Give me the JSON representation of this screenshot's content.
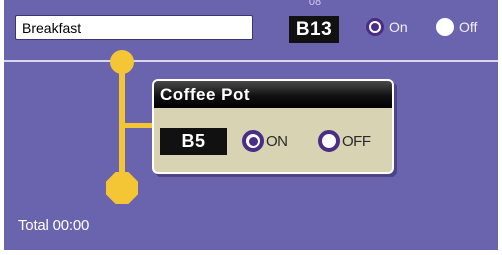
{
  "header": {
    "schedule_name": "Breakfast",
    "code": "B13",
    "code_shadow": "08",
    "on_label": "On",
    "off_label": "Off",
    "selected": "on"
  },
  "popup": {
    "title": "Coffee Pot",
    "code": "B5",
    "on_label": "ON",
    "off_label": "OFF",
    "selected": "on"
  },
  "footer": {
    "total_text": "Total 00:00"
  },
  "colors": {
    "background": "#6a63ad",
    "connector": "#f4c534",
    "popup_body": "#d8d3b2",
    "radio_accent": "#4a2e86"
  }
}
